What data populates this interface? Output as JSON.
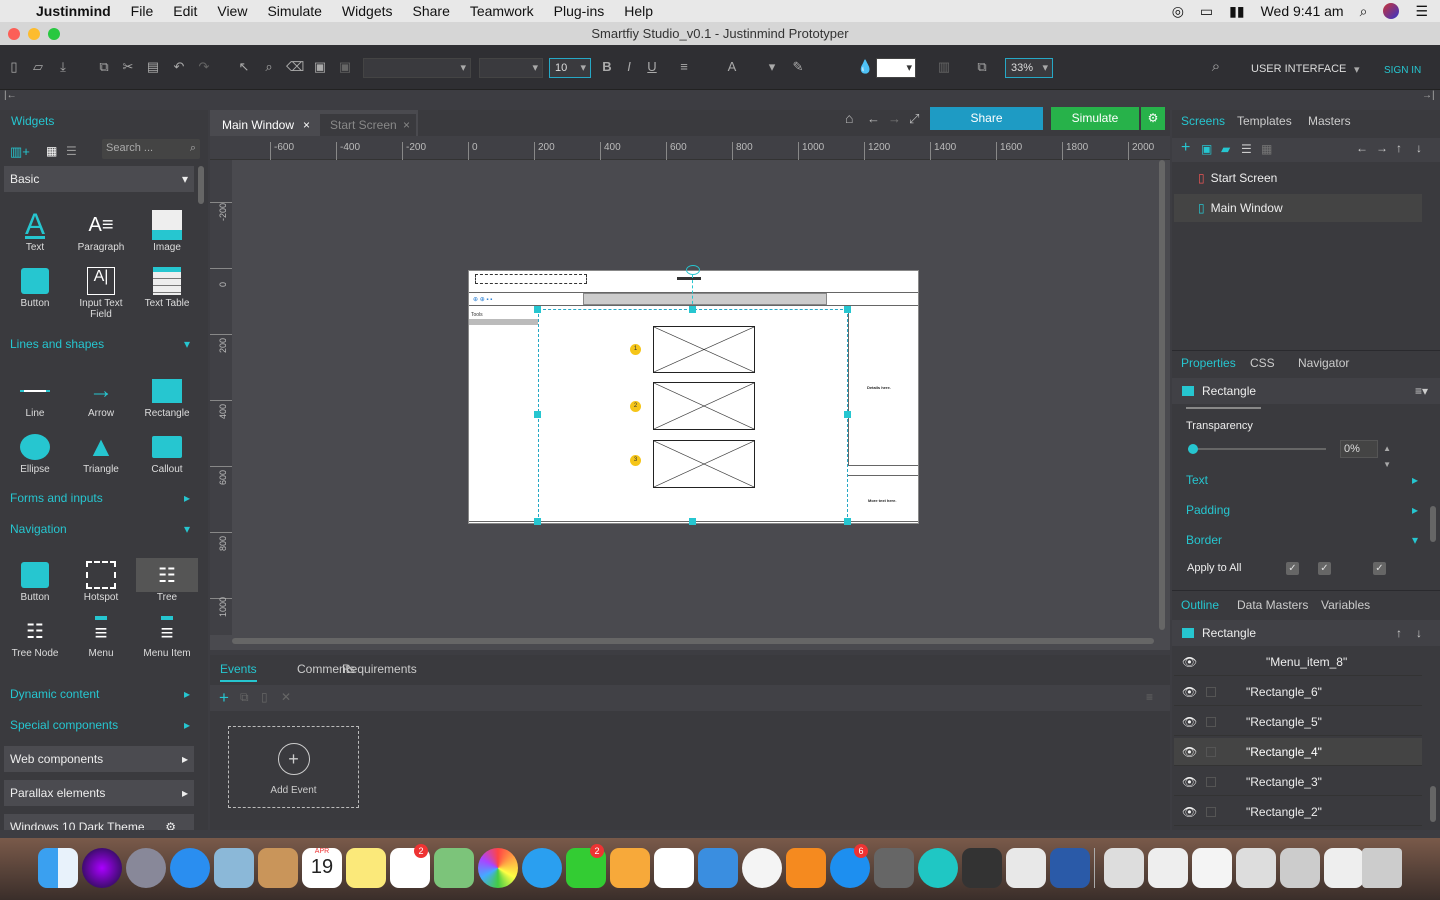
{
  "menubar": {
    "app": "Justinmind",
    "items": [
      "File",
      "Edit",
      "View",
      "Simulate",
      "Widgets",
      "Share",
      "Teamwork",
      "Plug-ins",
      "Help"
    ],
    "clock": "Wed 9:41 am"
  },
  "window": {
    "title": "Smartfiy Studio_v0.1 - Justinmind Prototyper"
  },
  "toolbar": {
    "font_size": "10",
    "zoom": "33%",
    "ui_mode": "USER INTERFACE",
    "sign_in": "SIGN IN",
    "bold": "B",
    "italic": "I",
    "underline": "U",
    "text_tool": "A"
  },
  "left_panel": {
    "tab": "Widgets",
    "search_placeholder": "Search ...",
    "category": "Basic",
    "basic": [
      "Text",
      "Paragraph",
      "Image",
      "Button",
      "Input Text Field",
      "Text Table"
    ],
    "sections": {
      "lines": "Lines and shapes",
      "forms": "Forms and inputs",
      "navigation": "Navigation",
      "dynamic": "Dynamic content",
      "special": "Special components",
      "web": "Web components",
      "parallax": "Parallax elements",
      "win10": "Windows 10 Dark Theme"
    },
    "shapes": [
      "Line",
      "Arrow",
      "Rectangle",
      "Ellipse",
      "Triangle",
      "Callout"
    ],
    "nav": [
      "Button",
      "Hotspot",
      "Tree",
      "Tree Node",
      "Menu",
      "Menu Item"
    ]
  },
  "canvas": {
    "tabs": [
      "Main Window",
      "Start Screen"
    ],
    "share": "Share",
    "simulate": "Simulate",
    "ruler_h": [
      "-600",
      "-400",
      "-200",
      "0",
      "200",
      "400",
      "600",
      "800",
      "1000",
      "1200",
      "1400",
      "1600",
      "1800",
      "2000"
    ],
    "ruler_v": [
      "-200",
      "0",
      "200",
      "400",
      "600",
      "800",
      "1000"
    ],
    "wire": {
      "tools": "Tools",
      "details": "Details here.",
      "more": "More text here.",
      "badges": [
        "1",
        "2",
        "3"
      ]
    }
  },
  "bottom": {
    "tabs": [
      "Events",
      "Comments",
      "Requirements"
    ],
    "add_event": "Add Event"
  },
  "right_panel": {
    "tabs": [
      "Screens",
      "Templates",
      "Masters"
    ],
    "screens": [
      "Start Screen",
      "Main Window"
    ],
    "prop_tabs": [
      "Properties",
      "CSS",
      "Navigator"
    ],
    "selected": "Rectangle",
    "transparency_label": "Transparency",
    "transparency": "0%",
    "groups": [
      "Text",
      "Padding",
      "Border"
    ],
    "apply_all": "Apply to All",
    "outline_tabs": [
      "Outline",
      "Data Masters",
      "Variables"
    ],
    "outline_root": "Rectangle",
    "outline_items": [
      "\"Menu_item_8\"",
      "\"Rectangle_6\"",
      "\"Rectangle_5\"",
      "\"Rectangle_4\"",
      "\"Rectangle_3\"",
      "\"Rectangle_2\""
    ]
  },
  "dock": {
    "calendar_month": "APR",
    "calendar_day": "19",
    "badges": [
      "2",
      "2",
      "6"
    ]
  },
  "colors": {
    "accent": "#26c6d0",
    "share": "#1e9bc4",
    "simulate": "#27b24a"
  }
}
